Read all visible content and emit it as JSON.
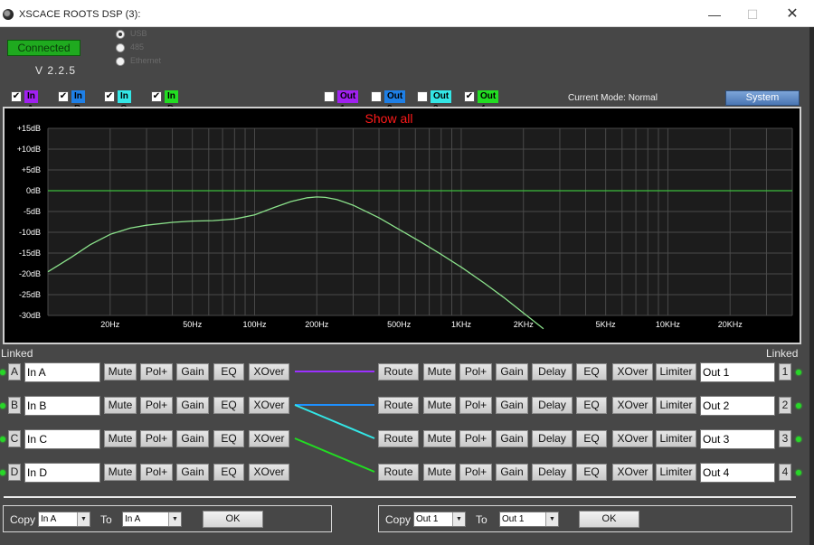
{
  "window": {
    "title": "XSCACE ROOTS DSP (3):",
    "min_glyph": "—",
    "max_glyph": "☐",
    "close_glyph": "✕"
  },
  "status": {
    "connected_label": "Connected",
    "version": "V 2.2.5"
  },
  "connection_modes": [
    {
      "label": "USB",
      "selected": true
    },
    {
      "label": "485",
      "selected": false
    },
    {
      "label": "Ethernet",
      "selected": false
    }
  ],
  "inputs_filter": [
    {
      "label": "In A",
      "checked": true,
      "color": "#a020f0"
    },
    {
      "label": "In B",
      "checked": true,
      "color": "#1e7fe6"
    },
    {
      "label": "In C",
      "checked": true,
      "color": "#33e6e6"
    },
    {
      "label": "In D",
      "checked": true,
      "color": "#22dd22"
    }
  ],
  "outputs_filter": [
    {
      "label": "Out 1",
      "checked": false,
      "color": "#a020f0"
    },
    {
      "label": "Out 2",
      "checked": false,
      "color": "#1e7fe6"
    },
    {
      "label": "Out 3",
      "checked": false,
      "color": "#33e6e6"
    },
    {
      "label": "Out 4",
      "checked": true,
      "color": "#22dd22"
    }
  ],
  "current_mode": "Current Mode:  Normal",
  "system_button": "System",
  "chart_data": {
    "type": "line",
    "title": "Show all",
    "title_color": "#ff1a1a",
    "x_scale": "log",
    "xlim": [
      10,
      40000
    ],
    "ylim": [
      -30,
      15
    ],
    "x_tick_labels": [
      "20Hz",
      "50Hz",
      "100Hz",
      "200Hz",
      "500Hz",
      "1KHz",
      "2KHz",
      "5KHz",
      "10KHz",
      "20KHz"
    ],
    "x_ticks": [
      20,
      50,
      100,
      200,
      500,
      1000,
      2000,
      5000,
      10000,
      20000
    ],
    "y_tick_labels": [
      "+15dB",
      "+10dB",
      "+5dB",
      "0dB",
      "-5dB",
      "-10dB",
      "-15dB",
      "-20dB",
      "-25dB",
      "-30dB"
    ],
    "y_ticks": [
      15,
      10,
      5,
      0,
      -5,
      -10,
      -15,
      -20,
      -25,
      -30
    ],
    "grid": true,
    "series": [
      {
        "color": "#3dbb3d",
        "x": [
          10,
          40000
        ],
        "y": [
          0,
          0
        ]
      },
      {
        "color": "#8be28b",
        "x": [
          10,
          13,
          16,
          20,
          25,
          30,
          40,
          50,
          63,
          80,
          100,
          125,
          150,
          180,
          200,
          220,
          250,
          300,
          400,
          500,
          630,
          800,
          1000,
          1300,
          1600,
          2000,
          2500
        ],
        "y": [
          -19.5,
          -16,
          -13,
          -10.5,
          -9,
          -8.3,
          -7.6,
          -7.3,
          -7.2,
          -6.8,
          -5.8,
          -4,
          -2.6,
          -1.7,
          -1.5,
          -1.6,
          -2.1,
          -3.5,
          -6.5,
          -9.3,
          -12.2,
          -15.3,
          -18.4,
          -22.3,
          -25.6,
          -29.4,
          -33.2
        ]
      }
    ]
  },
  "linked_label": "Linked",
  "input_channels": [
    {
      "letter": "A",
      "name": "In A"
    },
    {
      "letter": "B",
      "name": "In B"
    },
    {
      "letter": "C",
      "name": "In C"
    },
    {
      "letter": "D",
      "name": "In D"
    }
  ],
  "input_buttons": [
    "Mute",
    "Pol+",
    "Gain",
    "EQ",
    "XOver"
  ],
  "output_channels": [
    {
      "number": "1",
      "name": "Out 1"
    },
    {
      "number": "2",
      "name": "Out 2"
    },
    {
      "number": "3",
      "name": "Out 3"
    },
    {
      "number": "4",
      "name": "Out 4"
    }
  ],
  "output_buttons": [
    "Route",
    "Mute",
    "Pol+",
    "Gain",
    "Delay",
    "EQ",
    "XOver",
    "Limiter"
  ],
  "routing": [
    {
      "from": 0,
      "to": 0,
      "color": "#9b30ff"
    },
    {
      "from": 1,
      "to": 1,
      "color": "#1e90ff"
    },
    {
      "from": 1,
      "to": 2,
      "color": "#33e6e6"
    },
    {
      "from": 2,
      "to": 3,
      "color": "#22dd22"
    }
  ],
  "copy_inputs": {
    "copy_label": "Copy",
    "to_label": "To",
    "source": "In A",
    "target": "In A",
    "ok": "OK",
    "arrow": "▼"
  },
  "copy_outputs": {
    "copy_label": "Copy",
    "to_label": "To",
    "source": "Out 1",
    "target": "Out 1",
    "ok": "OK",
    "arrow": "▼"
  }
}
